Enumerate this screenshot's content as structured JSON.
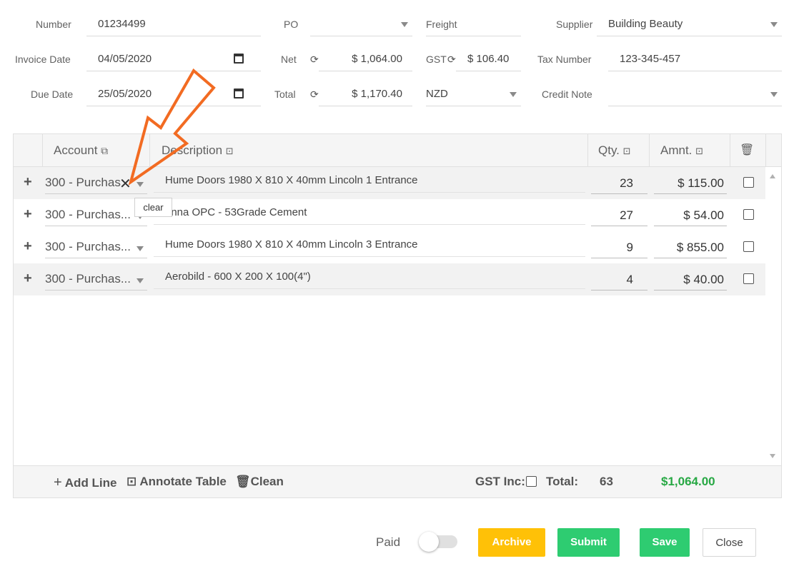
{
  "header": {
    "number_label": "Number",
    "number_value": "01234499",
    "po_label": "PO",
    "po_value": "",
    "freight_label": "Freight",
    "freight_value": "",
    "supplier_label": "Supplier",
    "supplier_value": "Building Beauty",
    "invoice_date_label": "Invoice Date",
    "invoice_date_value": "04/05/2020",
    "net_label": "Net",
    "net_value": "$ 1,064.00",
    "gst_label": "GST",
    "gst_value": "$ 106.40",
    "tax_number_label": "Tax Number",
    "tax_number_value": "123-345-457",
    "due_date_label": "Due Date",
    "due_date_value": "25/05/2020",
    "total_label": "Total",
    "total_value": "$ 1,170.40",
    "currency_value": "NZD",
    "credit_note_label": "Credit Note",
    "credit_note_value": ""
  },
  "table": {
    "columns": {
      "account": "Account",
      "description": "Description",
      "qty": "Qty.",
      "amount": "Amnt."
    },
    "rows": [
      {
        "account": "300 - Purchas",
        "description": "Hume Doors 1980 X 810 X 40mm Lincoln 1 Entrance",
        "qty": "23",
        "amount": "$ 115.00"
      },
      {
        "account": "300 - Purchas...",
        "description": "enna OPC - 53Grade Cement",
        "qty": "27",
        "amount": "$ 54.00"
      },
      {
        "account": "300 - Purchas...",
        "description": "Hume Doors 1980 X 810 X 40mm Lincoln 3 Entrance",
        "qty": "9",
        "amount": "$ 855.00"
      },
      {
        "account": "300 - Purchas...",
        "description": "Aerobild - 600 X 200 X 100(4\")",
        "qty": "4",
        "amount": "$ 40.00"
      }
    ],
    "tooltip": "clear",
    "footer": {
      "add_line": "Add Line",
      "annotate_table": "Annotate Table",
      "clean": "Clean",
      "gst_inc_label": "GST Inc:",
      "total_label": "Total:",
      "total_qty": "63",
      "total_amount": "$1,064.00"
    }
  },
  "actions": {
    "paid_label": "Paid",
    "archive": "Archive",
    "submit": "Submit",
    "save": "Save",
    "close": "Close"
  },
  "colors": {
    "archive": "#ffc107",
    "submit": "#2ecc71",
    "save": "#2ecc71",
    "total_amount": "#27a844",
    "annotation_arrow": "#f26b22"
  },
  "icons": {
    "sync": "sync-icon",
    "calendar": "calendar-icon",
    "caret": "caret-down-icon",
    "copy": "copy-icon",
    "trash": "trash-icon"
  }
}
